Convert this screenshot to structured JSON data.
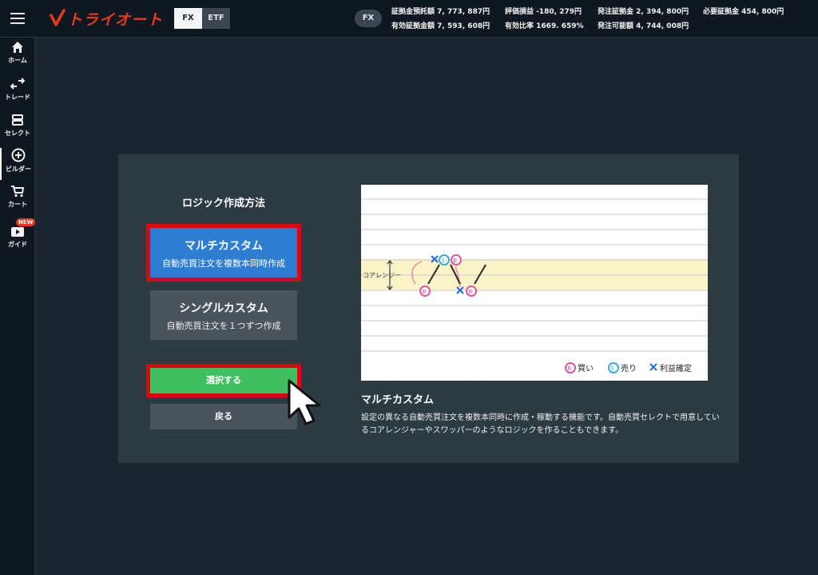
{
  "header": {
    "logo_text": "トライオート",
    "modes": [
      "FX",
      "ETF"
    ],
    "market_badge": "FX",
    "account": {
      "deposit_label": "証拠金預託額",
      "deposit_value": "7, 773, 887円",
      "pnl_label": "評価損益",
      "pnl_value": "-180, 279円",
      "order_margin_label": "発注証拠金",
      "order_margin_value": "2, 394, 800円",
      "required_margin_label": "必要証拠金",
      "required_margin_value": "454, 800円",
      "effective_margin_label": "有効証拠金額",
      "effective_margin_value": "7, 593, 608円",
      "effective_ratio_label": "有効比率",
      "effective_ratio_value": "1669. 659%",
      "orderable_label": "発注可能額",
      "orderable_value": "4, 744, 008円"
    }
  },
  "sidebar": {
    "items": [
      {
        "label": "ホーム",
        "icon": "home-icon"
      },
      {
        "label": "トレード",
        "icon": "trade-arrows-icon"
      },
      {
        "label": "セレクト",
        "icon": "select-stack-icon"
      },
      {
        "label": "ビルダー",
        "icon": "plus-circle-icon"
      },
      {
        "label": "カート",
        "icon": "cart-icon"
      },
      {
        "label": "ガイド",
        "icon": "play-video-icon",
        "badge": "NEW"
      }
    ]
  },
  "dialog": {
    "title": "ロジック作成方法",
    "options": [
      {
        "title": "マルチカスタム",
        "subtitle": "自動売買注文を複数本同時作成"
      },
      {
        "title": "シングルカスタム",
        "subtitle": "自動売買注文を１つずつ作成"
      }
    ],
    "select_button": "選択する",
    "back_button": "戻る",
    "diagram": {
      "range_label": "コアレンジー",
      "legend": [
        {
          "glyph": "B",
          "label": "買い",
          "color": "#e0559a"
        },
        {
          "glyph": "S",
          "label": "売り",
          "color": "#3aa9e0"
        },
        {
          "glyph": "✕",
          "label": "利益確定",
          "color": "#1e6ed8"
        }
      ]
    },
    "description_title": "マルチカスタム",
    "description_body": "設定の異なる自動売買注文を複数本同時に作成・稼動する機能です。自動売買セレクトで用意しているコアレンジャーやスワッパーのようなロジックを作ることもできます。"
  }
}
